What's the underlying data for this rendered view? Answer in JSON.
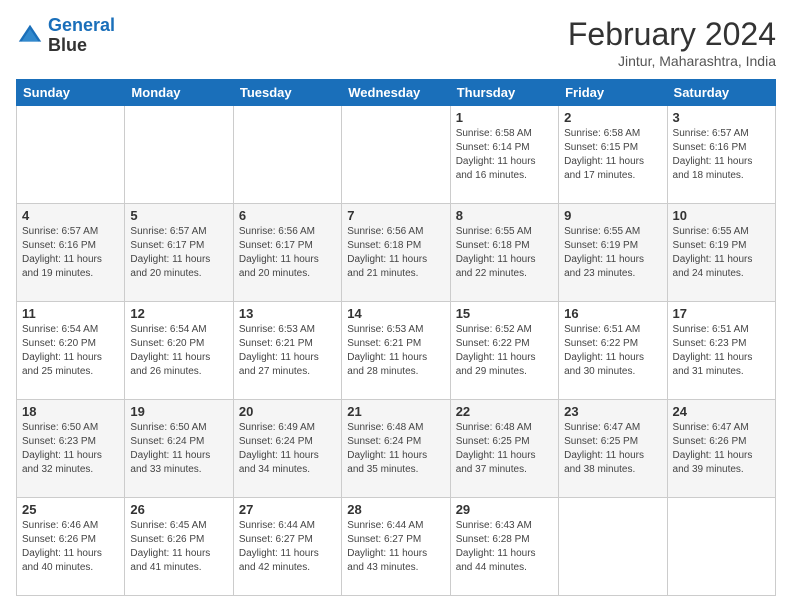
{
  "header": {
    "logo_line1": "General",
    "logo_line2": "Blue",
    "title": "February 2024",
    "subtitle": "Jintur, Maharashtra, India"
  },
  "days_of_week": [
    "Sunday",
    "Monday",
    "Tuesday",
    "Wednesday",
    "Thursday",
    "Friday",
    "Saturday"
  ],
  "weeks": [
    [
      {
        "day": "",
        "info": ""
      },
      {
        "day": "",
        "info": ""
      },
      {
        "day": "",
        "info": ""
      },
      {
        "day": "",
        "info": ""
      },
      {
        "day": "1",
        "info": "Sunrise: 6:58 AM\nSunset: 6:14 PM\nDaylight: 11 hours and 16 minutes."
      },
      {
        "day": "2",
        "info": "Sunrise: 6:58 AM\nSunset: 6:15 PM\nDaylight: 11 hours and 17 minutes."
      },
      {
        "day": "3",
        "info": "Sunrise: 6:57 AM\nSunset: 6:16 PM\nDaylight: 11 hours and 18 minutes."
      }
    ],
    [
      {
        "day": "4",
        "info": "Sunrise: 6:57 AM\nSunset: 6:16 PM\nDaylight: 11 hours and 19 minutes."
      },
      {
        "day": "5",
        "info": "Sunrise: 6:57 AM\nSunset: 6:17 PM\nDaylight: 11 hours and 20 minutes."
      },
      {
        "day": "6",
        "info": "Sunrise: 6:56 AM\nSunset: 6:17 PM\nDaylight: 11 hours and 20 minutes."
      },
      {
        "day": "7",
        "info": "Sunrise: 6:56 AM\nSunset: 6:18 PM\nDaylight: 11 hours and 21 minutes."
      },
      {
        "day": "8",
        "info": "Sunrise: 6:55 AM\nSunset: 6:18 PM\nDaylight: 11 hours and 22 minutes."
      },
      {
        "day": "9",
        "info": "Sunrise: 6:55 AM\nSunset: 6:19 PM\nDaylight: 11 hours and 23 minutes."
      },
      {
        "day": "10",
        "info": "Sunrise: 6:55 AM\nSunset: 6:19 PM\nDaylight: 11 hours and 24 minutes."
      }
    ],
    [
      {
        "day": "11",
        "info": "Sunrise: 6:54 AM\nSunset: 6:20 PM\nDaylight: 11 hours and 25 minutes."
      },
      {
        "day": "12",
        "info": "Sunrise: 6:54 AM\nSunset: 6:20 PM\nDaylight: 11 hours and 26 minutes."
      },
      {
        "day": "13",
        "info": "Sunrise: 6:53 AM\nSunset: 6:21 PM\nDaylight: 11 hours and 27 minutes."
      },
      {
        "day": "14",
        "info": "Sunrise: 6:53 AM\nSunset: 6:21 PM\nDaylight: 11 hours and 28 minutes."
      },
      {
        "day": "15",
        "info": "Sunrise: 6:52 AM\nSunset: 6:22 PM\nDaylight: 11 hours and 29 minutes."
      },
      {
        "day": "16",
        "info": "Sunrise: 6:51 AM\nSunset: 6:22 PM\nDaylight: 11 hours and 30 minutes."
      },
      {
        "day": "17",
        "info": "Sunrise: 6:51 AM\nSunset: 6:23 PM\nDaylight: 11 hours and 31 minutes."
      }
    ],
    [
      {
        "day": "18",
        "info": "Sunrise: 6:50 AM\nSunset: 6:23 PM\nDaylight: 11 hours and 32 minutes."
      },
      {
        "day": "19",
        "info": "Sunrise: 6:50 AM\nSunset: 6:24 PM\nDaylight: 11 hours and 33 minutes."
      },
      {
        "day": "20",
        "info": "Sunrise: 6:49 AM\nSunset: 6:24 PM\nDaylight: 11 hours and 34 minutes."
      },
      {
        "day": "21",
        "info": "Sunrise: 6:48 AM\nSunset: 6:24 PM\nDaylight: 11 hours and 35 minutes."
      },
      {
        "day": "22",
        "info": "Sunrise: 6:48 AM\nSunset: 6:25 PM\nDaylight: 11 hours and 37 minutes."
      },
      {
        "day": "23",
        "info": "Sunrise: 6:47 AM\nSunset: 6:25 PM\nDaylight: 11 hours and 38 minutes."
      },
      {
        "day": "24",
        "info": "Sunrise: 6:47 AM\nSunset: 6:26 PM\nDaylight: 11 hours and 39 minutes."
      }
    ],
    [
      {
        "day": "25",
        "info": "Sunrise: 6:46 AM\nSunset: 6:26 PM\nDaylight: 11 hours and 40 minutes."
      },
      {
        "day": "26",
        "info": "Sunrise: 6:45 AM\nSunset: 6:26 PM\nDaylight: 11 hours and 41 minutes."
      },
      {
        "day": "27",
        "info": "Sunrise: 6:44 AM\nSunset: 6:27 PM\nDaylight: 11 hours and 42 minutes."
      },
      {
        "day": "28",
        "info": "Sunrise: 6:44 AM\nSunset: 6:27 PM\nDaylight: 11 hours and 43 minutes."
      },
      {
        "day": "29",
        "info": "Sunrise: 6:43 AM\nSunset: 6:28 PM\nDaylight: 11 hours and 44 minutes."
      },
      {
        "day": "",
        "info": ""
      },
      {
        "day": "",
        "info": ""
      }
    ]
  ]
}
